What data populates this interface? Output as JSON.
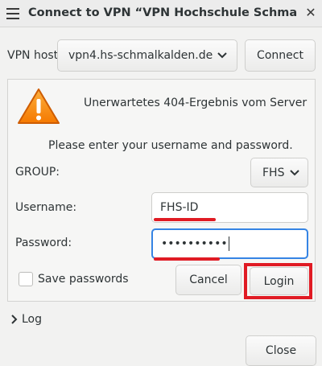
{
  "window": {
    "title": "Connect to VPN “VPN Hochschule Schmal…",
    "menu_icon": "hamburger-menu-icon",
    "close_icon": "close-icon",
    "close_glyph": "✕"
  },
  "host_row": {
    "label": "VPN host",
    "host_value": "vpn4.hs-schmalkalden.de",
    "connect_label": "Connect"
  },
  "auth": {
    "warning_icon": "warning-triangle-icon",
    "error_message": "Unerwartetes 404-Ergebnis vom Server",
    "prompt": "Please enter your username and password.",
    "group_label": "GROUP:",
    "group_value": "FHS",
    "username_label": "Username:",
    "username_value": "FHS-ID",
    "password_label": "Password:",
    "password_value": "••••••••••",
    "save_passwords_label": "Save passwords",
    "save_passwords_checked": false,
    "cancel_label": "Cancel",
    "login_label": "Login"
  },
  "log": {
    "label": "Log",
    "expander_icon": "chevron-right-icon"
  },
  "footer": {
    "close_label": "Close"
  },
  "colors": {
    "annotation_red": "#e01b24",
    "focus_blue": "#3584e4",
    "warning_orange": "#f57900"
  }
}
